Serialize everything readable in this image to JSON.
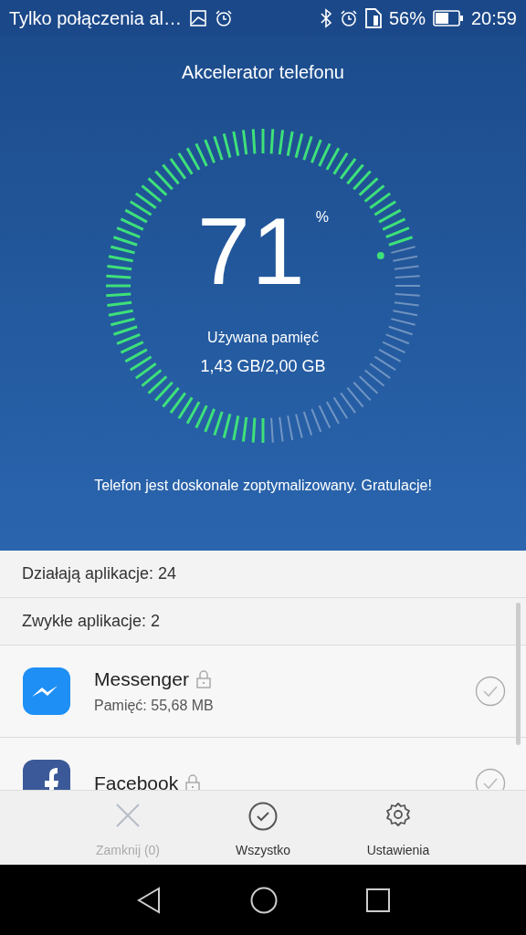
{
  "status_bar": {
    "notification": "Tylko połączenia al…",
    "battery": "56%",
    "time": "20:59"
  },
  "header": {
    "title": "Akcelerator telefonu",
    "gauge": {
      "value": "71",
      "unit": "%",
      "label": "Używana pamięć",
      "reading": "1,43 GB/2,00 GB"
    },
    "message": "Telefon jest doskonale zoptymalizowany. Gratulacje!"
  },
  "running": "Działają aplikacje: 24",
  "section": "Zwykłe aplikacje: 2",
  "apps": [
    {
      "name": "Messenger",
      "kind": "messenger",
      "memory": "Pamięć: 55,68 MB",
      "locked": true,
      "checked": false
    },
    {
      "name": "Facebook",
      "kind": "facebook",
      "locked": true,
      "checked": false
    }
  ],
  "actions": [
    {
      "label": "Zamknij (0)",
      "kind": "close",
      "disabled": true
    },
    {
      "label": "Wszystko",
      "kind": "all",
      "disabled": false
    },
    {
      "label": "Ustawienia",
      "kind": "settings",
      "disabled": false
    }
  ]
}
